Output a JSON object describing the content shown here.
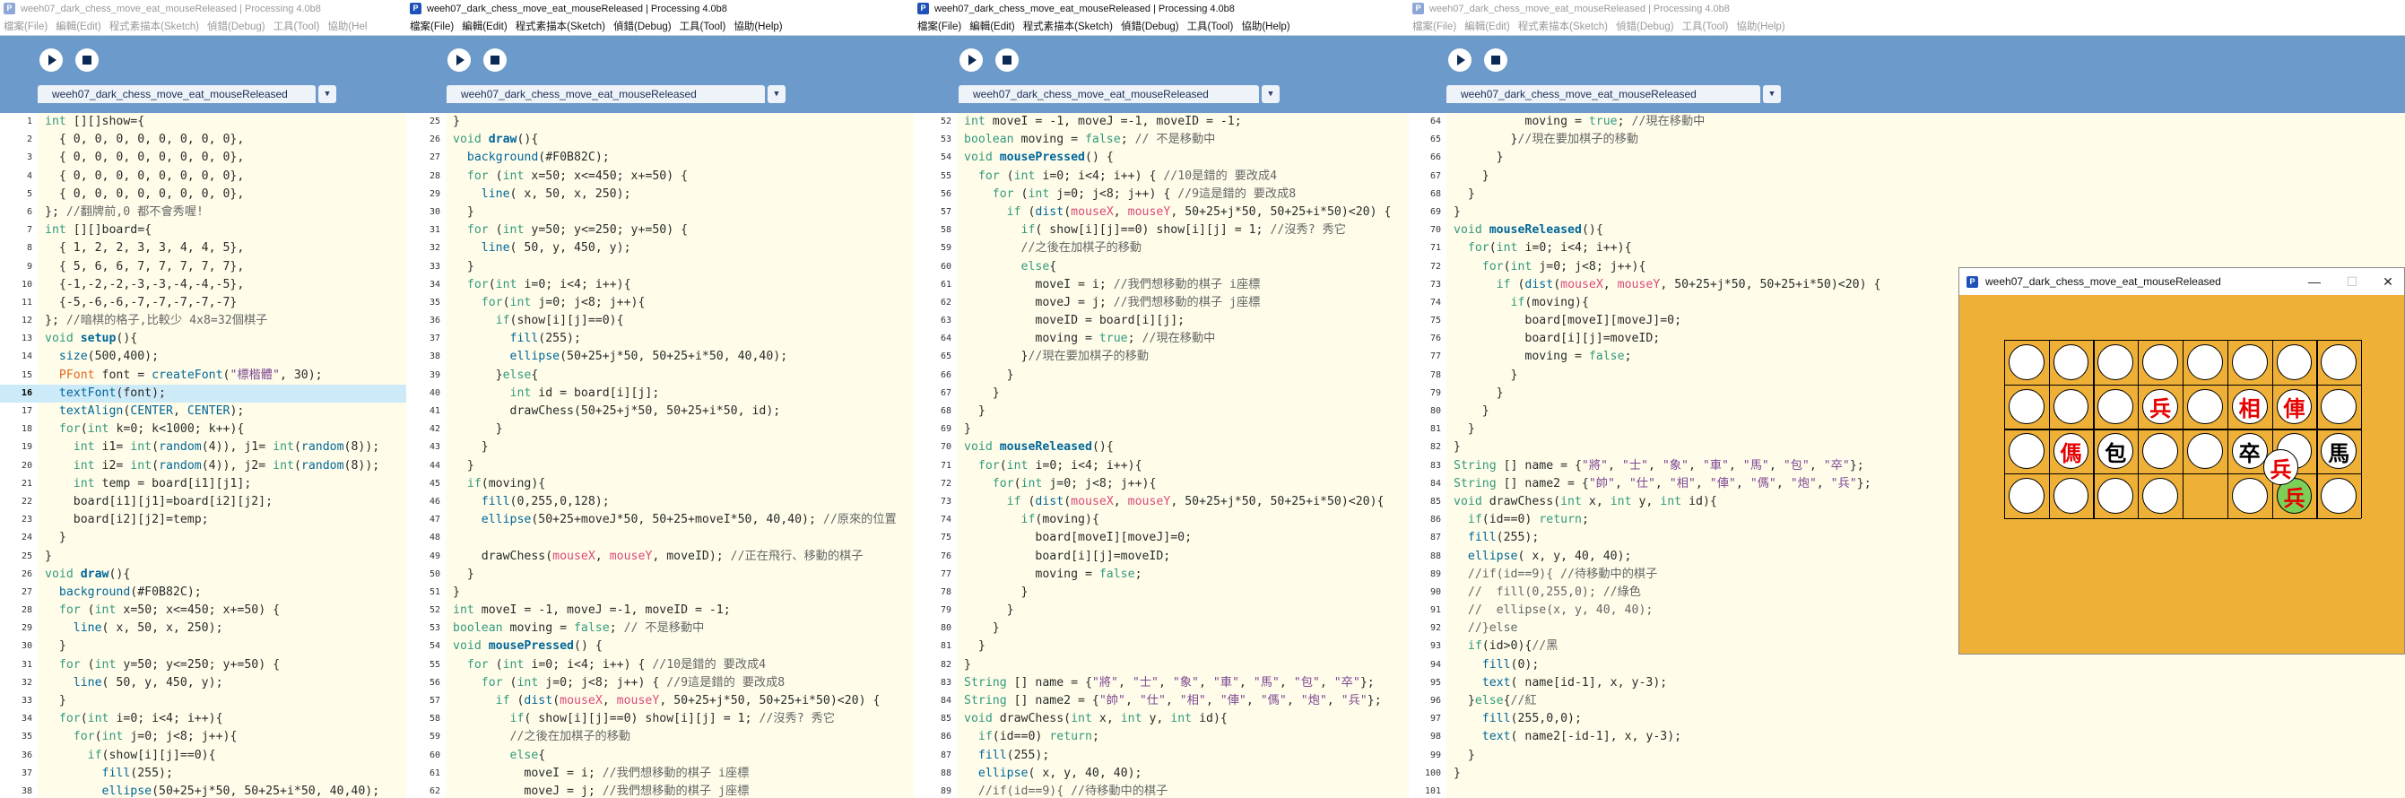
{
  "windows": [
    {
      "title": "weeh07_dark_chess_move_eat_mouseReleased | Processing 4.0b8",
      "tab": "weeh07_dark_chess_move_eat_mouseReleased",
      "dim": true
    },
    {
      "title": "weeh07_dark_chess_move_eat_mouseReleased | Processing 4.0b8",
      "tab": "weeh07_dark_chess_move_eat_mouseReleased",
      "dim": false
    },
    {
      "title": "weeh07_dark_chess_move_eat_mouseReleased | Processing 4.0b8",
      "tab": "weeh07_dark_chess_move_eat_mouseReleased",
      "dim": false
    },
    {
      "title": "weeh07_dark_chess_move_eat_mouseReleased | Processing 4.0b8",
      "tab": "weeh07_dark_chess_move_eat_mouseReleased",
      "dim": true
    }
  ],
  "menus": [
    "檔案(File)",
    "編輯(Edit)",
    "程式素描本(Sketch)",
    "偵錯(Debug)",
    "工具(Tool)",
    "協助(Help)"
  ],
  "menus_first_cut": [
    "檔案(File)",
    "編輯(Edit)",
    "程式素描本(Sketch)",
    "偵錯(Debug)",
    "工具(Tool)",
    "協助(Hel"
  ],
  "toolbar": {
    "run_icon": "play-icon",
    "stop_icon": "stop-icon"
  },
  "code": {
    "pane1": [
      [
        "1",
        "int [][]show={"
      ],
      [
        "2",
        "  { 0, 0, 0, 0, 0, 0, 0, 0},"
      ],
      [
        "3",
        "  { 0, 0, 0, 0, 0, 0, 0, 0},"
      ],
      [
        "4",
        "  { 0, 0, 0, 0, 0, 0, 0, 0},"
      ],
      [
        "5",
        "  { 0, 0, 0, 0, 0, 0, 0, 0},"
      ],
      [
        "6",
        "}; //翻牌前,0 都不會秀喔!"
      ],
      [
        "7",
        "int [][]board={"
      ],
      [
        "8",
        "  { 1, 2, 2, 3, 3, 4, 4, 5},"
      ],
      [
        "9",
        "  { 5, 6, 6, 7, 7, 7, 7, 7},"
      ],
      [
        "10",
        "  {-1,-2,-2,-3,-3,-4,-4,-5},"
      ],
      [
        "11",
        "  {-5,-6,-6,-7,-7,-7,-7,-7}"
      ],
      [
        "12",
        "}; //暗棋的格子,比較少 4x8=32個棋子"
      ],
      [
        "13",
        "void setup(){"
      ],
      [
        "14",
        "  size(500,400);"
      ],
      [
        "15",
        "  PFont font = createFont(\"標楷體\", 30);"
      ],
      [
        "16",
        "  textFont(font);"
      ],
      [
        "17",
        "  textAlign(CENTER, CENTER);"
      ],
      [
        "18",
        "  for(int k=0; k<1000; k++){"
      ],
      [
        "19",
        "    int i1= int(random(4)), j1= int(random(8));"
      ],
      [
        "20",
        "    int i2= int(random(4)), j2= int(random(8));"
      ],
      [
        "21",
        "    int temp = board[i1][j1];"
      ],
      [
        "22",
        "    board[i1][j1]=board[i2][j2];"
      ],
      [
        "23",
        "    board[i2][j2]=temp;"
      ],
      [
        "24",
        "  }"
      ],
      [
        "25",
        "}"
      ],
      [
        "26",
        "void draw(){"
      ],
      [
        "27",
        "  background(#F0B82C);"
      ],
      [
        "28",
        "  for (int x=50; x<=450; x+=50) {"
      ],
      [
        "29",
        "    line( x, 50, x, 250);"
      ],
      [
        "30",
        "  }"
      ],
      [
        "31",
        "  for (int y=50; y<=250; y+=50) {"
      ],
      [
        "32",
        "    line( 50, y, 450, y);"
      ],
      [
        "33",
        "  }"
      ],
      [
        "34",
        "  for(int i=0; i<4; i++){"
      ],
      [
        "35",
        "    for(int j=0; j<8; j++){"
      ],
      [
        "36",
        "      if(show[i][j]==0){"
      ],
      [
        "37",
        "        fill(255);"
      ],
      [
        "38",
        "        ellipse(50+25+j*50, 50+25+i*50, 40,40);"
      ]
    ],
    "pane2": [
      [
        "25",
        "}"
      ],
      [
        "26",
        "void draw(){"
      ],
      [
        "27",
        "  background(#F0B82C);"
      ],
      [
        "28",
        "  for (int x=50; x<=450; x+=50) {"
      ],
      [
        "29",
        "    line( x, 50, x, 250);"
      ],
      [
        "30",
        "  }"
      ],
      [
        "31",
        "  for (int y=50; y<=250; y+=50) {"
      ],
      [
        "32",
        "    line( 50, y, 450, y);"
      ],
      [
        "33",
        "  }"
      ],
      [
        "34",
        "  for(int i=0; i<4; i++){"
      ],
      [
        "35",
        "    for(int j=0; j<8; j++){"
      ],
      [
        "36",
        "      if(show[i][j]==0){"
      ],
      [
        "37",
        "        fill(255);"
      ],
      [
        "38",
        "        ellipse(50+25+j*50, 50+25+i*50, 40,40);"
      ],
      [
        "39",
        "      }else{"
      ],
      [
        "40",
        "        int id = board[i][j];"
      ],
      [
        "41",
        "        drawChess(50+25+j*50, 50+25+i*50, id);"
      ],
      [
        "42",
        "      }"
      ],
      [
        "43",
        "    }"
      ],
      [
        "44",
        "  }"
      ],
      [
        "45",
        "  if(moving){"
      ],
      [
        "46",
        "    fill(0,255,0,128);"
      ],
      [
        "47",
        "    ellipse(50+25+moveJ*50, 50+25+moveI*50, 40,40); //原來的位置"
      ],
      [
        "48",
        ""
      ],
      [
        "49",
        "    drawChess(mouseX, mouseY, moveID); //正在飛行、移動的棋子"
      ],
      [
        "50",
        "  }"
      ],
      [
        "51",
        "}"
      ],
      [
        "52",
        "int moveI = -1, moveJ =-1, moveID = -1;"
      ],
      [
        "53",
        "boolean moving = false; // 不是移動中"
      ],
      [
        "54",
        "void mousePressed() {"
      ],
      [
        "55",
        "  for (int i=0; i<4; i++) { //10是錯的 要改成4"
      ],
      [
        "56",
        "    for (int j=0; j<8; j++) { //9這是錯的 要改成8"
      ],
      [
        "57",
        "      if (dist(mouseX, mouseY, 50+25+j*50, 50+25+i*50)<20) {"
      ],
      [
        "58",
        "        if( show[i][j]==0) show[i][j] = 1; //沒秀? 秀它"
      ],
      [
        "59",
        "        //之後在加棋子的移動"
      ],
      [
        "60",
        "        else{"
      ],
      [
        "61",
        "          moveI = i; //我們想移動的棋子 i座標"
      ],
      [
        "62",
        "          moveJ = j; //我們想移動的棋子 j座標"
      ]
    ],
    "pane3": [
      [
        "52",
        "int moveI = -1, moveJ =-1, moveID = -1;"
      ],
      [
        "53",
        "boolean moving = false; // 不是移動中"
      ],
      [
        "54",
        "void mousePressed() {"
      ],
      [
        "55",
        "  for (int i=0; i<4; i++) { //10是錯的 要改成4"
      ],
      [
        "56",
        "    for (int j=0; j<8; j++) { //9這是錯的 要改成8"
      ],
      [
        "57",
        "      if (dist(mouseX, mouseY, 50+25+j*50, 50+25+i*50)<20) {"
      ],
      [
        "58",
        "        if( show[i][j]==0) show[i][j] = 1; //沒秀? 秀它"
      ],
      [
        "59",
        "        //之後在加棋子的移動"
      ],
      [
        "60",
        "        else{"
      ],
      [
        "61",
        "          moveI = i; //我們想移動的棋子 i座標"
      ],
      [
        "62",
        "          moveJ = j; //我們想移動的棋子 j座標"
      ],
      [
        "63",
        "          moveID = board[i][j];"
      ],
      [
        "64",
        "          moving = true; //現在移動中"
      ],
      [
        "65",
        "        }//現在要加棋子的移動"
      ],
      [
        "66",
        "      }"
      ],
      [
        "67",
        "    }"
      ],
      [
        "68",
        "  }"
      ],
      [
        "69",
        "}"
      ],
      [
        "70",
        "void mouseReleased(){"
      ],
      [
        "71",
        "  for(int i=0; i<4; i++){"
      ],
      [
        "72",
        "    for(int j=0; j<8; j++){"
      ],
      [
        "73",
        "      if (dist(mouseX, mouseY, 50+25+j*50, 50+25+i*50)<20){"
      ],
      [
        "74",
        "        if(moving){"
      ],
      [
        "75",
        "          board[moveI][moveJ]=0;"
      ],
      [
        "76",
        "          board[i][j]=moveID;"
      ],
      [
        "77",
        "          moving = false;"
      ],
      [
        "78",
        "        }"
      ],
      [
        "79",
        "      }"
      ],
      [
        "80",
        "    }"
      ],
      [
        "81",
        "  }"
      ],
      [
        "82",
        "}"
      ],
      [
        "83",
        "String [] name = {\"將\", \"士\", \"象\", \"車\", \"馬\", \"包\", \"卒\"};"
      ],
      [
        "84",
        "String [] name2 = {\"帥\", \"仕\", \"相\", \"俥\", \"傌\", \"炮\", \"兵\"};"
      ],
      [
        "85",
        "void drawChess(int x, int y, int id){"
      ],
      [
        "86",
        "  if(id==0) return;"
      ],
      [
        "87",
        "  fill(255);"
      ],
      [
        "88",
        "  ellipse( x, y, 40, 40);"
      ],
      [
        "89",
        "  //if(id==9){ //待移動中的棋子"
      ]
    ],
    "pane4": [
      [
        "64",
        "          moving = true; //現在移動中"
      ],
      [
        "65",
        "        }//現在要加棋子的移動"
      ],
      [
        "66",
        "      }"
      ],
      [
        "67",
        "    }"
      ],
      [
        "68",
        "  }"
      ],
      [
        "69",
        "}"
      ],
      [
        "70",
        "void mouseReleased(){"
      ],
      [
        "71",
        "  for(int i=0; i<4; i++){"
      ],
      [
        "72",
        "    for(int j=0; j<8; j++){"
      ],
      [
        "73",
        "      if (dist(mouseX, mouseY, 50+25+j*50, 50+25+i*50)<20) {"
      ],
      [
        "74",
        "        if(moving){"
      ],
      [
        "75",
        "          board[moveI][moveJ]=0;"
      ],
      [
        "76",
        "          board[i][j]=moveID;"
      ],
      [
        "77",
        "          moving = false;"
      ],
      [
        "78",
        "        }"
      ],
      [
        "79",
        "      }"
      ],
      [
        "80",
        "    }"
      ],
      [
        "81",
        "  }"
      ],
      [
        "82",
        "}"
      ],
      [
        "83",
        "String [] name = {\"將\", \"士\", \"象\", \"車\", \"馬\", \"包\", \"卒\"};"
      ],
      [
        "84",
        "String [] name2 = {\"帥\", \"仕\", \"相\", \"俥\", \"傌\", \"炮\", \"兵\"};"
      ],
      [
        "85",
        "void drawChess(int x, int y, int id){"
      ],
      [
        "86",
        "  if(id==0) return;"
      ],
      [
        "87",
        "  fill(255);"
      ],
      [
        "88",
        "  ellipse( x, y, 40, 40);"
      ],
      [
        "89",
        "  //if(id==9){ //待移動中的棋子"
      ],
      [
        "90",
        "  //  fill(0,255,0); //綠色"
      ],
      [
        "91",
        "  //  ellipse(x, y, 40, 40);"
      ],
      [
        "92",
        "  //}else"
      ],
      [
        "93",
        "  if(id>0){//黑"
      ],
      [
        "94",
        "    fill(0);"
      ],
      [
        "95",
        "    text( name[id-1], x, y-3);"
      ],
      [
        "96",
        "  }else{//紅"
      ],
      [
        "97",
        "    fill(255,0,0);"
      ],
      [
        "98",
        "    text( name2[-id-1], x, y-3);"
      ],
      [
        "99",
        "  }"
      ],
      [
        "100",
        "}"
      ],
      [
        "101",
        ""
      ]
    ]
  },
  "sketch_window": {
    "title": "weeh07_dark_chess_move_eat_mouseReleased",
    "minimize": "—",
    "maximize": "☐",
    "close": "✕",
    "background": "#EEB036",
    "pieces": [
      [
        "",
        "",
        "",
        "",
        "",
        "",
        "",
        ""
      ],
      [
        "",
        "",
        "",
        "兵",
        "",
        "相",
        "俥",
        ""
      ],
      [
        "",
        "傌",
        "包",
        "",
        "",
        "卒",
        "",
        "馬"
      ],
      [
        "",
        "",
        "",
        "",
        "",
        "",
        "兵",
        ""
      ]
    ],
    "piece_colors": [
      [
        "",
        "",
        "",
        "",
        "",
        "",
        "",
        ""
      ],
      [
        "",
        "",
        "",
        "red",
        "",
        "red",
        "red",
        ""
      ],
      [
        "",
        "red",
        "black",
        "",
        "",
        "black",
        "",
        "black"
      ],
      [
        "",
        "",
        "",
        "",
        "",
        "",
        "moving",
        ""
      ]
    ],
    "empty_cells": [
      [
        3,
        4
      ]
    ],
    "floating_piece": "兵",
    "floating_color": "red"
  }
}
